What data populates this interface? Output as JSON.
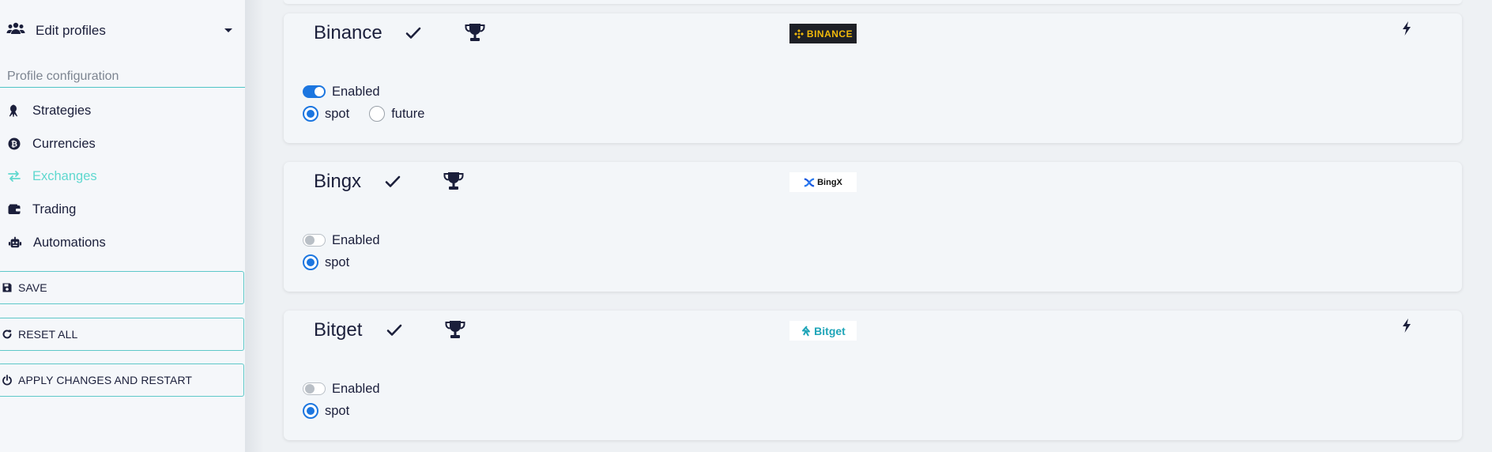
{
  "sidebar": {
    "profile_label": "Edit profiles",
    "section_title": "Profile configuration",
    "items": [
      {
        "label": "Strategies",
        "icon": "octopus-icon",
        "active": false
      },
      {
        "label": "Currencies",
        "icon": "bitcoin-icon",
        "active": false
      },
      {
        "label": "Exchanges",
        "icon": "swap-arrows-icon",
        "active": true
      },
      {
        "label": "Trading",
        "icon": "wallet-icon",
        "active": false
      },
      {
        "label": "Automations",
        "icon": "robot-icon",
        "active": false
      }
    ],
    "buttons": {
      "save": "SAVE",
      "reset": "RESET ALL",
      "apply": "APPLY CHANGES AND RESTART"
    }
  },
  "exchanges": [
    {
      "name": "Binance",
      "logo_text": "BINANCE",
      "enabled": true,
      "toggle_label": "Enabled",
      "has_bolt": true,
      "options": [
        {
          "label": "spot",
          "checked": true
        },
        {
          "label": "future",
          "checked": false
        }
      ]
    },
    {
      "name": "Bingx",
      "logo_text": "BingX",
      "enabled": false,
      "toggle_label": "Enabled",
      "has_bolt": false,
      "options": [
        {
          "label": "spot",
          "checked": true
        }
      ]
    },
    {
      "name": "Bitget",
      "logo_text": "Bitget",
      "enabled": false,
      "toggle_label": "Enabled",
      "has_bolt": true,
      "options": [
        {
          "label": "spot",
          "checked": true
        }
      ]
    }
  ],
  "colors": {
    "accent": "#5fd8cf",
    "primary": "#1c76e0",
    "text": "#1b1f3b",
    "border_teal": "#5ec8c9"
  }
}
